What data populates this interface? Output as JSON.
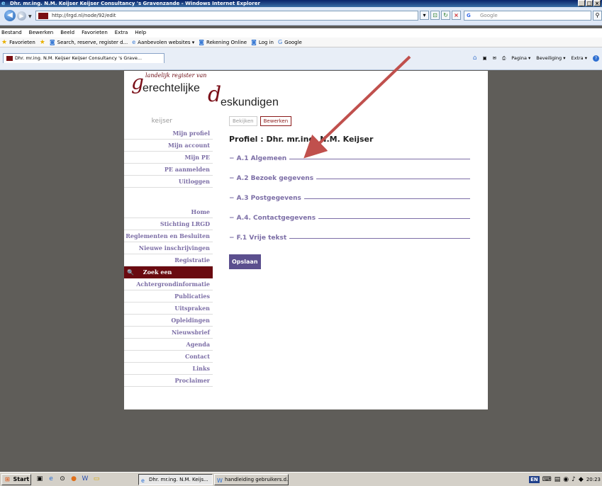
{
  "window": {
    "title": "Dhr. mr.ing. N.M. Keijser Keijser Consultancy 's Gravenzande - Windows Internet Explorer",
    "min": "_",
    "max": "□",
    "close": "×"
  },
  "address": {
    "url": "http://lrgd.nl/node/92/edit",
    "search_placeholder": "Google"
  },
  "menu": [
    "Bestand",
    "Bewerken",
    "Beeld",
    "Favorieten",
    "Extra",
    "Help"
  ],
  "favorites": {
    "label": "Favorieten",
    "items": [
      "Search, reserve, register d...",
      "Aanbevolen websites ▾",
      "Rekening Online",
      "Log in",
      "Google"
    ]
  },
  "browser_tab": {
    "title": "Dhr. mr.ing. N.M. Keijser Keijser Consultancy 's Grave..."
  },
  "command_bar": {
    "page": "Pagina ▾",
    "security": "Beveiliging ▾",
    "extra": "Extra ▾"
  },
  "logo": {
    "tagline": "landelijk register van",
    "g": "g",
    "word1": "erechtelijke",
    "d": "d",
    "word2": "eskundigen"
  },
  "sidebar": {
    "user": "keijser",
    "account_items": [
      "Mijn profiel",
      "Mijn account",
      "Mijn PE",
      "PE aanmelden",
      "Uitloggen"
    ],
    "nav_items": [
      "Home",
      "Stichting LRGD",
      "Reglementen en Besluiten",
      "Nieuwe inschrijvingen",
      "Registratie"
    ],
    "active_item": "Zoek een deskundige",
    "more_items": [
      "Achtergrondinformatie",
      "Publicaties",
      "Uitspraken",
      "Opleidingen",
      "Nieuwsbrief",
      "Agenda",
      "Contact",
      "Links",
      "Proclaimer"
    ]
  },
  "content": {
    "tab_view": "Bekijken",
    "tab_edit": "Bewerken",
    "title": "Profiel : Dhr. mr.ing. N.M. Keijser",
    "sections": [
      "− A.1 Algemeen",
      "− A.2 Bezoek gegevens",
      "− A.3 Postgegevens",
      "− A.4. Contactgegevens",
      "− F.1 Vrije tekst"
    ],
    "save": "Opslaan"
  },
  "taskbar": {
    "start": "Start",
    "tasks": [
      "Dhr. mr.ing. N.M. Keijs...",
      "handleiding gebruikers.d..."
    ],
    "lang": "EN",
    "clock": "20:23"
  },
  "colors": {
    "accent": "#7a0f18",
    "link": "#7c6ea6",
    "save": "#5b4f8e",
    "background": "#5f5d59",
    "arrow": "#c0504d"
  }
}
